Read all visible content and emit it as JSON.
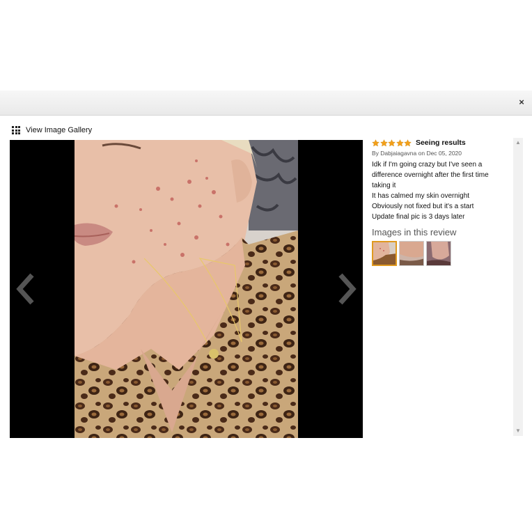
{
  "modal": {
    "close_label": "×",
    "gallery_label": "View Image Gallery"
  },
  "review": {
    "rating": 5,
    "rating_max": 5,
    "title": "Seeing results",
    "byline": "By Dabjaiagavna on Dec 05, 2020",
    "body_lines": [
      "Idk if I'm going crazy but I've seen a",
      "difference overnight after the first time",
      "taking it",
      "It has calmed my skin overnight",
      "Obviously not fixed but it's a start",
      "Update final pic is 3 days later"
    ],
    "images_heading": "Images in this review",
    "thumbnails": [
      {
        "selected": true
      },
      {
        "selected": false
      },
      {
        "selected": false
      }
    ]
  },
  "colors": {
    "star": "#f3a01a",
    "selected_border": "#e09a1f",
    "viewer_bg": "#000000"
  },
  "icons": {
    "grid": "grid-icon",
    "prev": "chevron-left-icon",
    "next": "chevron-right-icon",
    "close": "close-icon",
    "star": "star-icon"
  }
}
